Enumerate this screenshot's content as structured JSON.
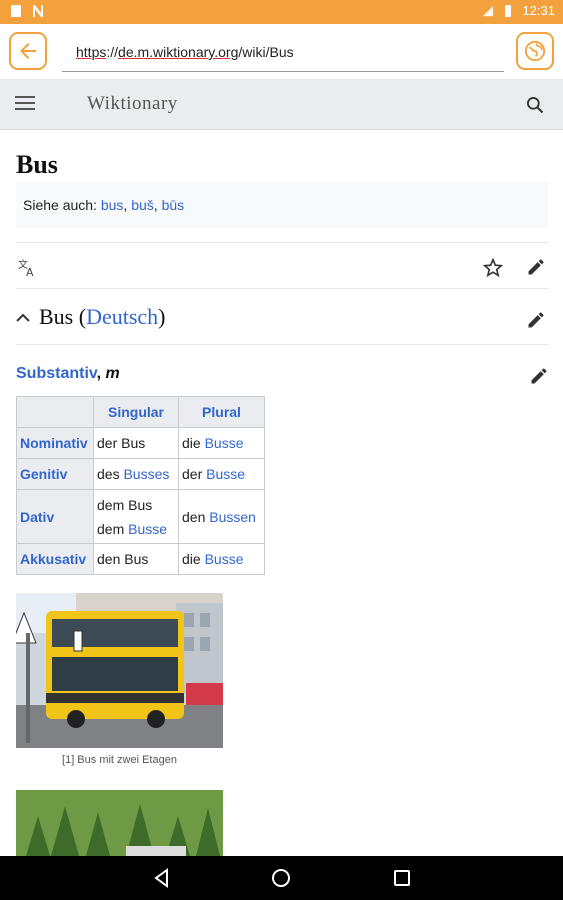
{
  "status_bar": {
    "time": "12:31"
  },
  "browser": {
    "url_part1": "https",
    "url_part2": "://",
    "url_part3": "de.m.wiktionary.org",
    "url_part4": "/wiki/Bus"
  },
  "app": {
    "brand": "Wiktionary"
  },
  "page": {
    "title": "Bus",
    "see_also_label": "Siehe auch:",
    "see_also_links": [
      "bus",
      "buš",
      "būs"
    ],
    "section_word": "Bus",
    "section_language": "Deutsch",
    "pos_label": "Substantiv",
    "pos_gender": "m"
  },
  "table": {
    "headers": [
      "Singular",
      "Plural"
    ],
    "rows": [
      {
        "case": "Nominativ",
        "sg_art": "der Bus",
        "sg_link": "",
        "pl_art": "die ",
        "pl_link": "Busse"
      },
      {
        "case": "Genitiv",
        "sg_art": "des ",
        "sg_link": "Busses",
        "pl_art": "der ",
        "pl_link": "Busse"
      },
      {
        "case": "Dativ",
        "sg_line1": "dem Bus",
        "sg_art": "dem ",
        "sg_link": "Busse",
        "pl_art": "den ",
        "pl_link": "Bussen"
      },
      {
        "case": "Akkusativ",
        "sg_art": "den Bus",
        "sg_link": "",
        "pl_art": "die ",
        "pl_link": "Busse"
      }
    ]
  },
  "image_caption": "[1] Bus mit zwei Etagen",
  "colors": {
    "accent": "#f2a13c",
    "link": "#3366cc",
    "header_bg": "#eaecf0"
  },
  "icons": [
    "back-arrow-icon",
    "globe-icon",
    "menu-icon",
    "search-icon",
    "translate-icon",
    "star-icon",
    "pencil-icon",
    "chevron-up-icon",
    "nav-back-icon",
    "nav-home-icon",
    "nav-recents-icon"
  ]
}
